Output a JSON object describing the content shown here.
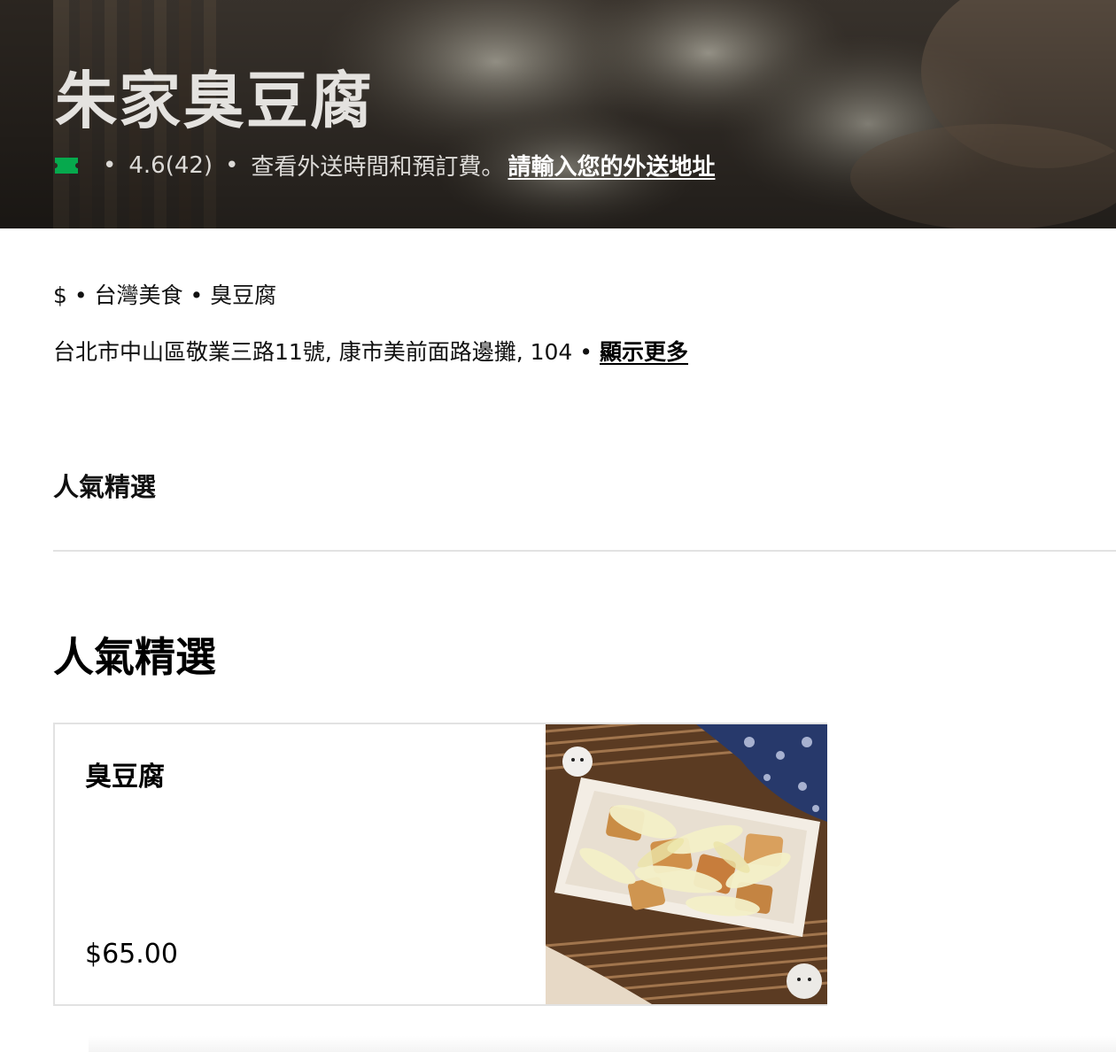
{
  "store": {
    "name": "朱家臭豆腐",
    "rating": "4.6",
    "review_count": "(42)",
    "delivery_info": "查看外送時間和預訂費。",
    "address_prompt": "請輸入您的外送地址",
    "ticket_icon": "ticket-icon",
    "accent_color": "#06a94d"
  },
  "details": {
    "category_line": "$ • 台灣美食 • 臭豆腐",
    "address_line": "台北市中山區敬業三路11號, 康市美前面路邊攤, 104 • ",
    "show_more": "顯示更多"
  },
  "nav": {
    "tab_label": "人氣精選"
  },
  "section": {
    "title": "人氣精選",
    "items": [
      {
        "name": "臭豆腐",
        "price": "$65.00"
      }
    ]
  }
}
